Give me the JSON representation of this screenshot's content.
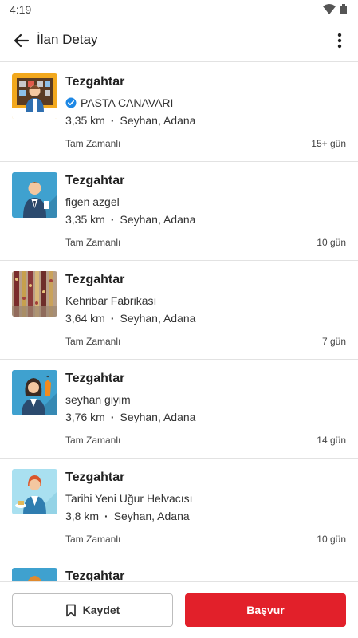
{
  "status_bar": {
    "time": "4:19"
  },
  "app_bar": {
    "title": "İlan Detay"
  },
  "listings": [
    {
      "title": "Tezgahtar",
      "company": "PASTA CANAVARI",
      "verified": true,
      "distance": "3,35 km",
      "location": "Seyhan, Adana",
      "type": "Tam Zamanlı",
      "age": "15+ gün"
    },
    {
      "title": "Tezgahtar",
      "company": "figen azgel",
      "verified": false,
      "distance": "3,35 km",
      "location": "Seyhan, Adana",
      "type": "Tam Zamanlı",
      "age": "10 gün"
    },
    {
      "title": "Tezgahtar",
      "company": "Kehribar Fabrikası",
      "verified": false,
      "distance": "3,64 km",
      "location": "Seyhan, Adana",
      "type": "Tam Zamanlı",
      "age": "7 gün"
    },
    {
      "title": "Tezgahtar",
      "company": "seyhan giyim",
      "verified": false,
      "distance": "3,76 km",
      "location": "Seyhan, Adana",
      "type": "Tam Zamanlı",
      "age": "14 gün"
    },
    {
      "title": "Tezgahtar",
      "company": "Tarihi Yeni Uğur Helvacısı",
      "verified": false,
      "distance": "3,8 km",
      "location": "Seyhan, Adana",
      "type": "Tam Zamanlı",
      "age": "10 gün"
    },
    {
      "title": "Tezgahtar"
    }
  ],
  "bottom_bar": {
    "save_label": "Kaydet",
    "apply_label": "Başvur"
  },
  "colors": {
    "accent": "#e2202a",
    "verified": "#1e88e5"
  }
}
